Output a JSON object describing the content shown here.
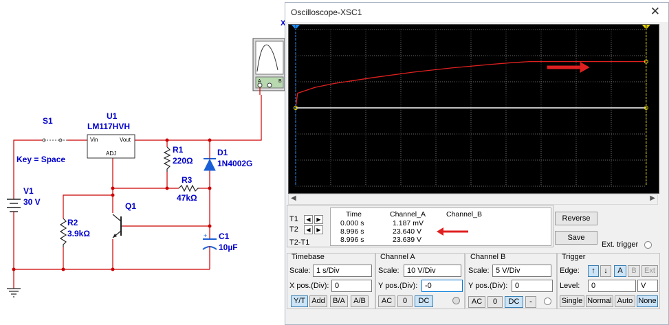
{
  "schematic": {
    "switch": {
      "ref": "S1",
      "key": "Key = Space"
    },
    "battery": {
      "ref": "V1",
      "value": "30 V"
    },
    "regulator": {
      "ref": "U1",
      "part": "LM117HVH",
      "pin_in": "Vin",
      "pin_out": "Vout",
      "pin_adj": "ADJ"
    },
    "r1": {
      "ref": "R1",
      "value": "220Ω"
    },
    "r2": {
      "ref": "R2",
      "value": "3.9kΩ"
    },
    "r3": {
      "ref": "R3",
      "value": "47kΩ"
    },
    "d1": {
      "ref": "D1",
      "value": "1N4002G"
    },
    "q1": {
      "ref": "Q1"
    },
    "c1": {
      "ref": "C1",
      "value": "10µF"
    },
    "scope_label": "X",
    "scope_pin_a": "A",
    "scope_pin_b": "B"
  },
  "window": {
    "title": "Oscilloscope-XSC1",
    "close": "✕"
  },
  "screen": {
    "cursor1_label": "1",
    "cursor2_label": "2",
    "trace_color": "#e02020",
    "flat_color": "#ffffff",
    "annotation_arrow_color": "#e02020"
  },
  "cursors": {
    "t1_label": "T1",
    "t2_label": "T2",
    "diff_label": "T2-T1",
    "headers": {
      "time": "Time",
      "a": "Channel_A",
      "b": "Channel_B"
    },
    "rows": [
      {
        "time": "0.000 s",
        "a": "1.187 mV",
        "b": ""
      },
      {
        "time": "8.996 s",
        "a": "23.640 V",
        "b": ""
      },
      {
        "time": "8.996 s",
        "a": "23.639 V",
        "b": ""
      }
    ]
  },
  "buttons": {
    "reverse": "Reverse",
    "save": "Save",
    "ext_trigger": "Ext. trigger"
  },
  "timebase": {
    "title": "Timebase",
    "scale_label": "Scale:",
    "scale": "1 s/Div",
    "xpos_label": "X pos.(Div):",
    "xpos": "0",
    "modes": [
      "Y/T",
      "Add",
      "B/A",
      "A/B"
    ]
  },
  "channel_a": {
    "title": "Channel A",
    "scale_label": "Scale:",
    "scale": "10 V/Div",
    "ypos_label": "Y pos.(Div):",
    "ypos": "-0",
    "coupling": [
      "AC",
      "0",
      "DC"
    ]
  },
  "channel_b": {
    "title": "Channel B",
    "scale_label": "Scale:",
    "scale": "5 V/Div",
    "ypos_label": "Y pos.(Div):",
    "ypos": "0",
    "coupling": [
      "AC",
      "0",
      "DC",
      "-"
    ]
  },
  "trigger": {
    "title": "Trigger",
    "edge_label": "Edge:",
    "edge_rise": "↑",
    "edge_fall": "↓",
    "sources": [
      "A",
      "B",
      "Ext"
    ],
    "level_label": "Level:",
    "level": "0",
    "level_unit": "V",
    "modes": [
      "Single",
      "Normal",
      "Auto",
      "None"
    ]
  },
  "chart_data": {
    "type": "line",
    "x_unit": "s",
    "y_unit": "V",
    "xlim": [
      0,
      9
    ],
    "ylim": [
      -40,
      40
    ],
    "series": [
      {
        "x": [
          0,
          0.05,
          0.5,
          1,
          2,
          3,
          4,
          5,
          5.5,
          6,
          7,
          8,
          8.996
        ],
        "y": [
          0,
          7.5,
          10.5,
          12.5,
          15.5,
          18.2,
          20.4,
          22.2,
          23.0,
          23.64,
          23.64,
          23.64,
          23.64
        ]
      },
      {
        "x": [
          0,
          8.996
        ],
        "y": [
          0,
          0
        ]
      }
    ],
    "cursors": [
      0,
      8.996
    ]
  }
}
